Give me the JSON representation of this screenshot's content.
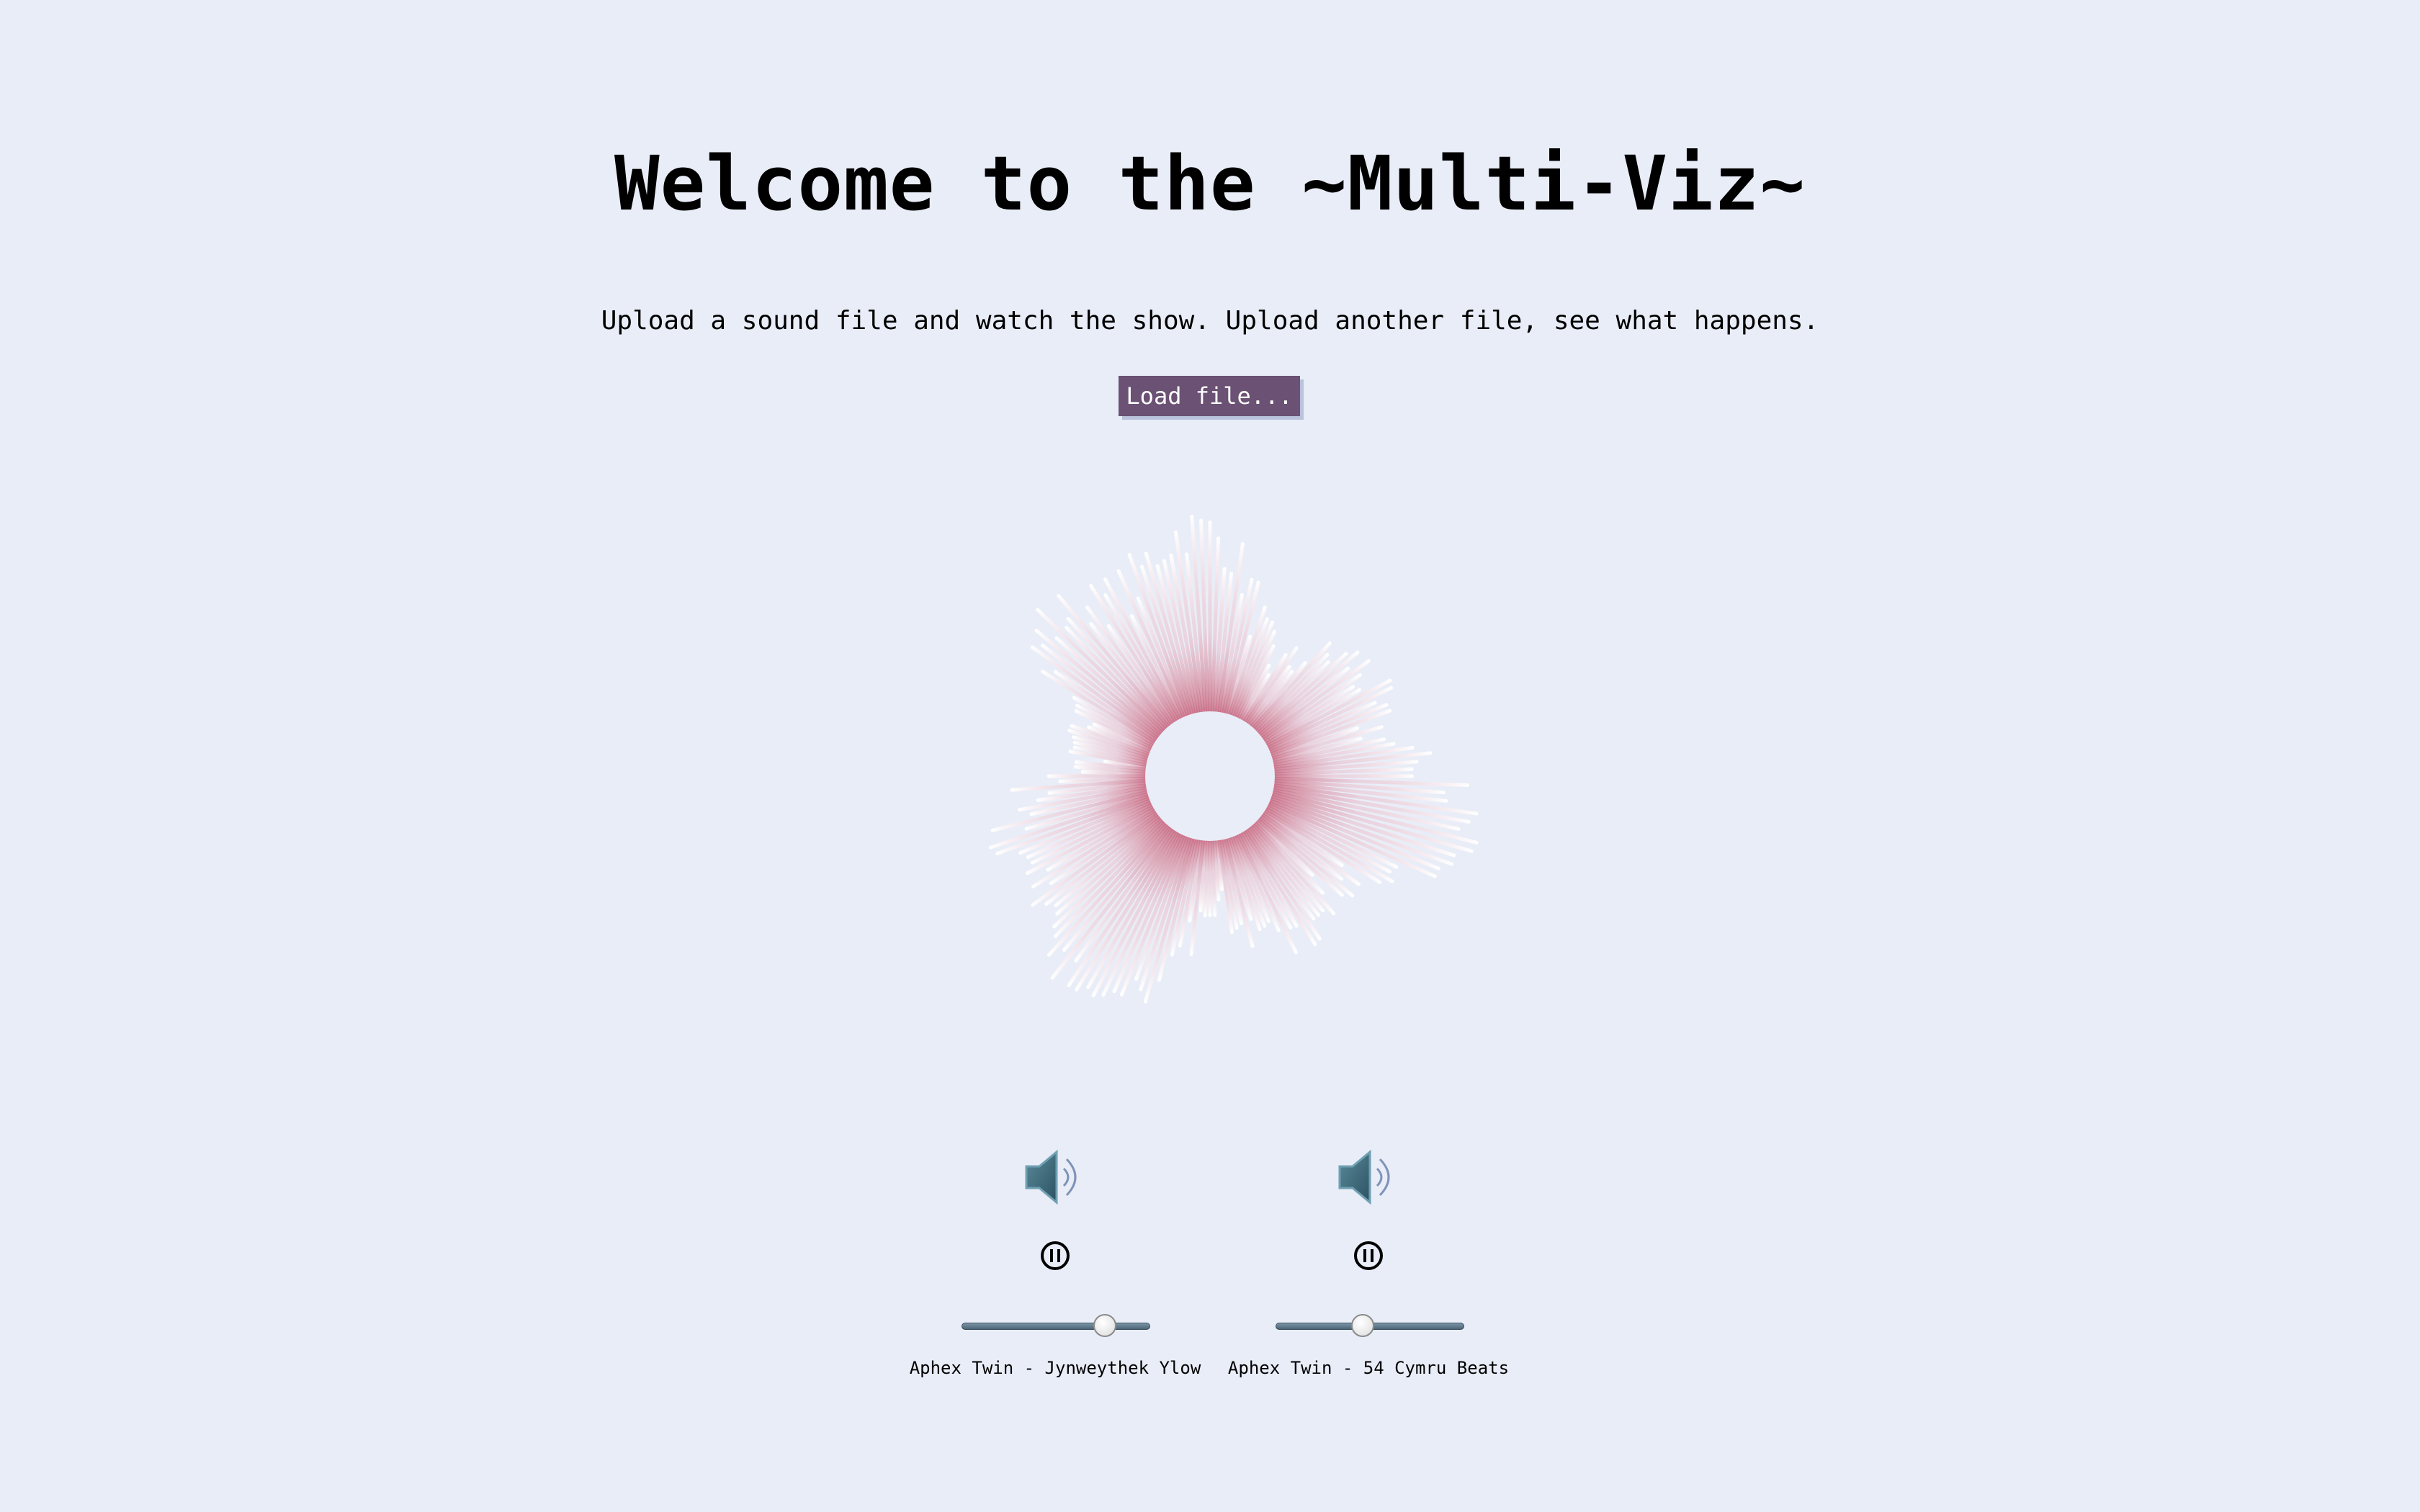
{
  "header": {
    "title": "Welcome to the ~Multi-Viz~",
    "subtitle": "Upload a sound file and watch the show. Upload another file, see what happens."
  },
  "load_button": {
    "label": "Load file..."
  },
  "visualizer": {
    "inner_color": "#c86a82",
    "outer_color": "#ffffff"
  },
  "players": [
    {
      "track_name": "Aphex Twin - Jynweythek Ylow",
      "volume": 0.76,
      "state": "playing",
      "speaker_icon": "speaker-icon",
      "pause_icon": "pause-icon"
    },
    {
      "track_name": "Aphex Twin - 54 Cymru Beats",
      "volume": 0.46,
      "state": "playing",
      "speaker_icon": "speaker-icon",
      "pause_icon": "pause-icon"
    }
  ],
  "colors": {
    "background": "#e9edf7",
    "button": "#6b5173",
    "speaker": "#3d6a7a"
  }
}
